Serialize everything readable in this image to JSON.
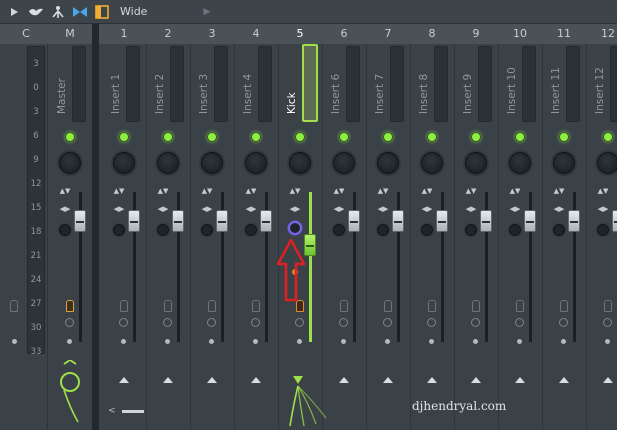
{
  "toolbar": {
    "label": "Wide",
    "icons": [
      "play-arrow-icon",
      "bird-icon",
      "person-up-icon",
      "bow-tie-icon",
      "window-icon",
      "menu-arrow-icon"
    ]
  },
  "headers": [
    "C",
    "M",
    "1",
    "2",
    "3",
    "4",
    "5",
    "6",
    "7",
    "8",
    "9",
    "10",
    "11",
    "12"
  ],
  "selected_header": "5",
  "strips": {
    "master_name": "Master",
    "inserts": [
      "Insert 1",
      "Insert 2",
      "Insert 3",
      "Insert 4",
      "Kick",
      "Insert 6",
      "Insert 7",
      "Insert 8",
      "Insert 9",
      "Insert 10",
      "Insert 11",
      "Insert 12"
    ],
    "selected_index": 4
  },
  "ruler": [
    "3",
    "0",
    "3",
    "6",
    "9",
    "12",
    "15",
    "18",
    "21",
    "24",
    "27",
    "30",
    "33"
  ],
  "watermark": "djhendryal.com",
  "colors": {
    "accent_green": "#9fe04a",
    "led_green": "#8cf03c",
    "annotation_red": "#e02020",
    "cursor_orange": "#e6862a"
  }
}
